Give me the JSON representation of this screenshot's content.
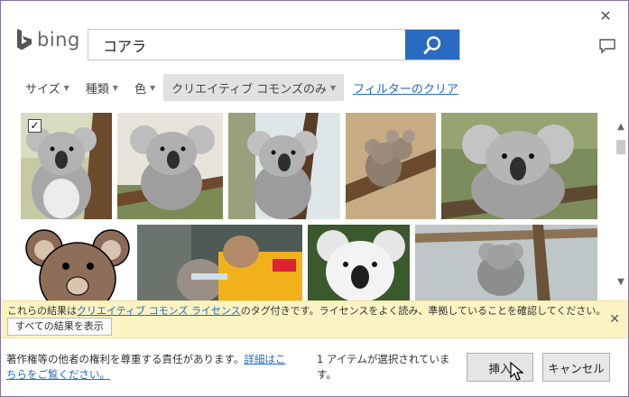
{
  "dialog": {
    "close_glyph": "✕"
  },
  "brand": {
    "name": "bing"
  },
  "search": {
    "query": "コアラ",
    "placeholder": ""
  },
  "filters": {
    "size_label": "サイズ",
    "type_label": "種類",
    "color_label": "色",
    "license_label": "クリエイティブ コモンズのみ",
    "clear_label": "フィルターのクリア"
  },
  "results": {
    "selected_check": "✓"
  },
  "license_bar": {
    "text_before": "これらの結果は",
    "link_text": "クリエイティブ コモンズ ライセンス",
    "text_after": "のタグ付きです。ライセンスをよく読み、準拠していることを確認してください。",
    "show_all_label": "すべての結果を表示",
    "close_glyph": "✕"
  },
  "footer": {
    "note_text": "著作権等の他者の権利を尊重する責任があります。",
    "note_link": "詳細はこちらをご覧ください。",
    "selected_count_text": "1 アイテムが選択されています。",
    "insert_label": "挿入",
    "cancel_label": "キャンセル"
  },
  "colors": {
    "accent": "#2a6bc1",
    "link": "#1f6cc1",
    "info_bar": "#fcf3c2"
  }
}
